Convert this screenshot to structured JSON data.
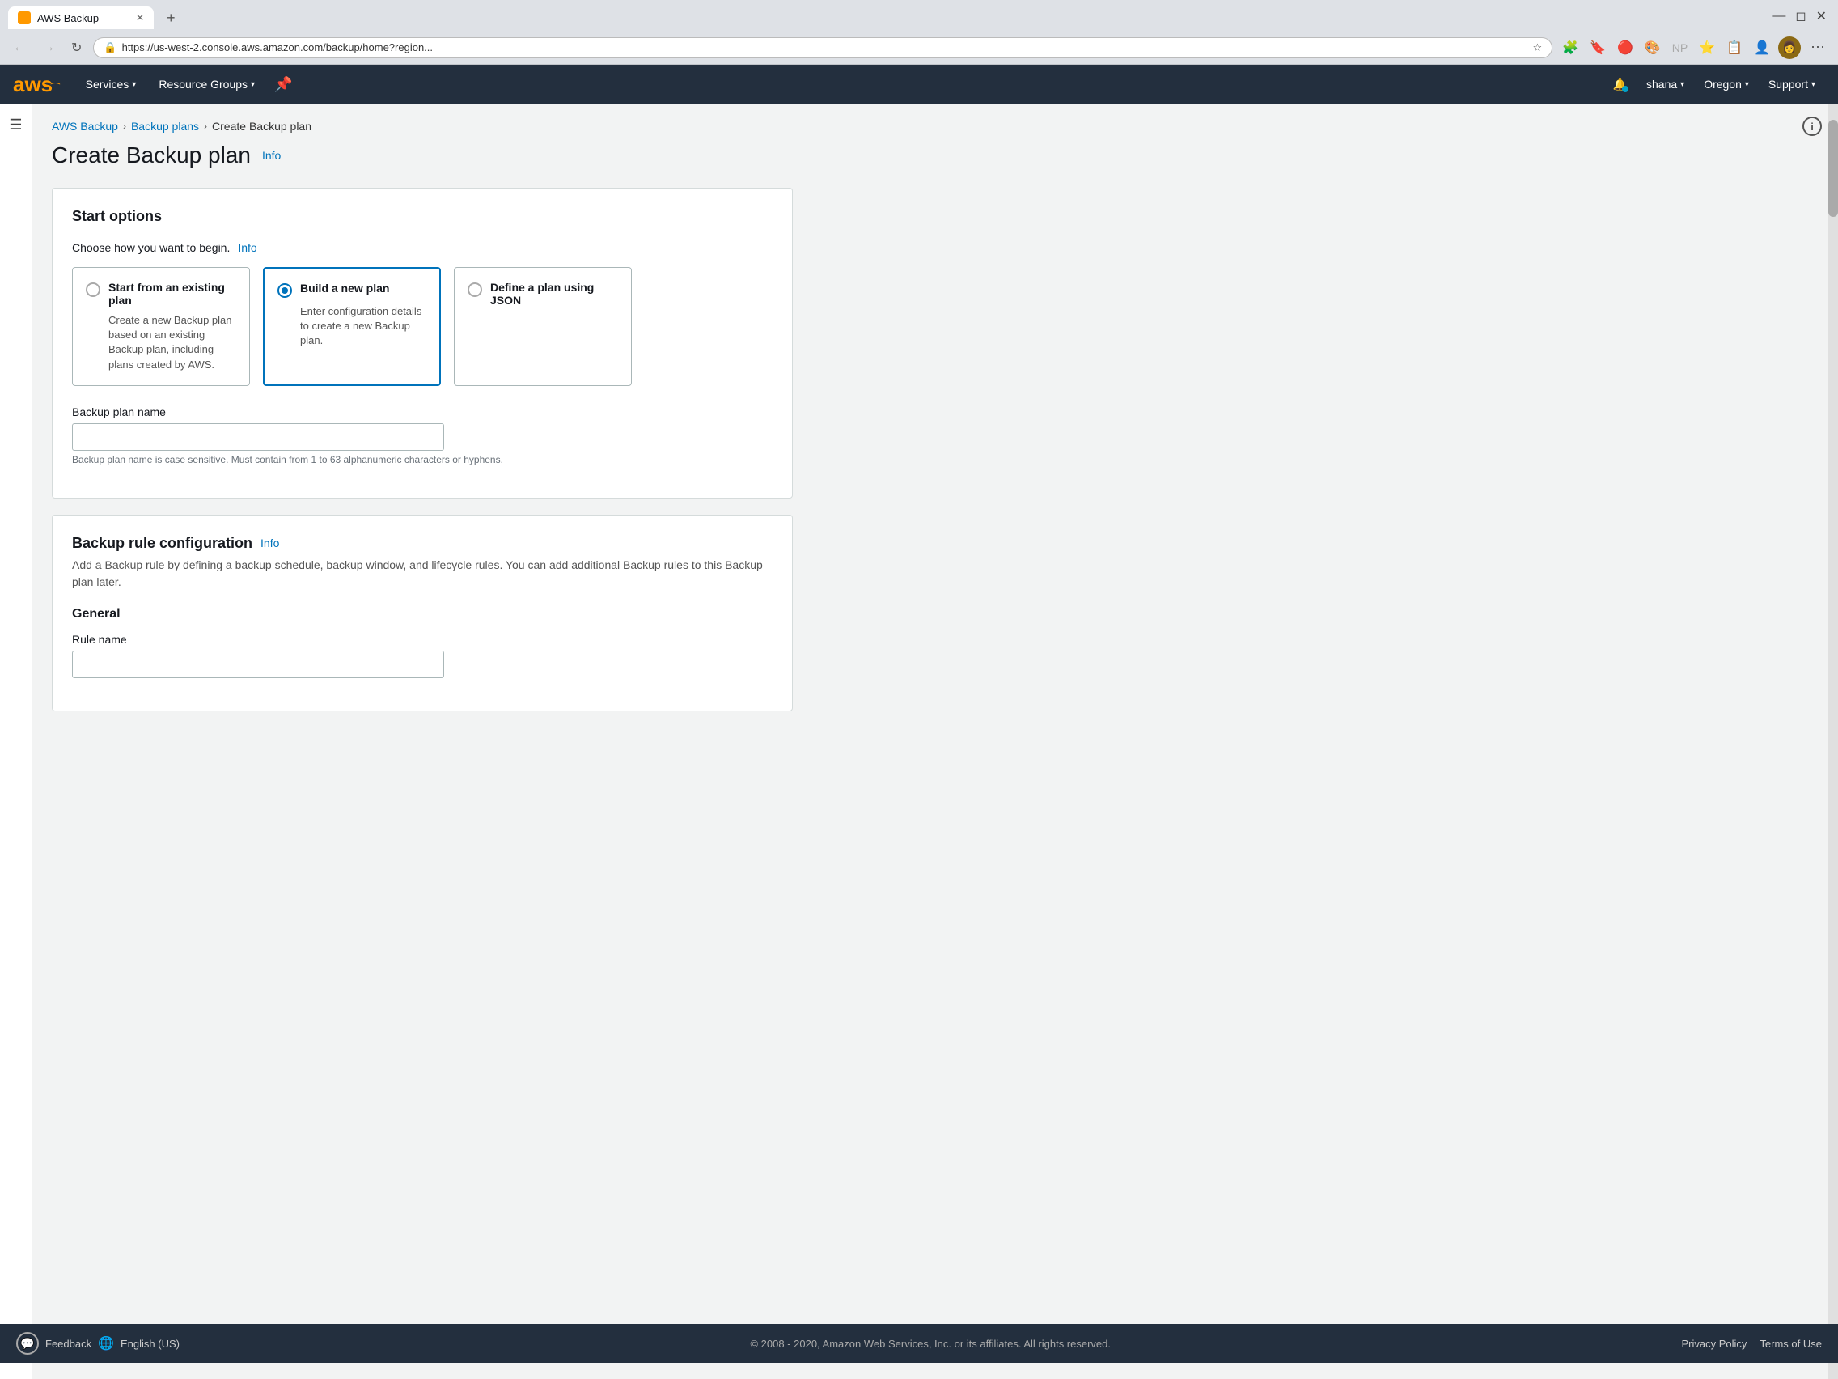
{
  "browser": {
    "tab_title": "AWS Backup",
    "tab_favicon": "🟠",
    "url": "https://us-west-2.console.aws.amazon.com/backup/home?region...",
    "new_tab_btn": "+",
    "back_btn": "←",
    "forward_btn": "→",
    "refresh_btn": "↻",
    "lock_icon": "🔒",
    "star_icon": "☆",
    "menu_btn": "⋯"
  },
  "aws_nav": {
    "logo_text": "aws",
    "services_label": "Services",
    "resource_groups_label": "Resource Groups",
    "bell_icon": "🔔",
    "user_name": "shana",
    "region_label": "Oregon",
    "support_label": "Support"
  },
  "breadcrumb": {
    "aws_backup": "AWS Backup",
    "backup_plans": "Backup plans",
    "current": "Create Backup plan"
  },
  "page": {
    "title": "Create Backup plan",
    "info_link": "Info"
  },
  "start_options": {
    "card_title": "Start options",
    "choose_label": "Choose how you want to begin.",
    "choose_info": "Info",
    "option1": {
      "title": "Start from an existing plan",
      "desc": "Create a new Backup plan based on an existing Backup plan, including plans created by AWS."
    },
    "option2": {
      "title": "Build a new plan",
      "desc": "Enter configuration details to create a new Backup plan."
    },
    "option3": {
      "title": "Define a plan using JSON"
    },
    "backup_plan_name_label": "Backup plan name",
    "backup_plan_name_placeholder": "",
    "backup_plan_name_hint": "Backup plan name is case sensitive. Must contain from 1 to 63 alphanumeric characters or hyphens."
  },
  "backup_rule_config": {
    "section_title": "Backup rule configuration",
    "info_link": "Info",
    "section_desc": "Add a Backup rule by defining a backup schedule, backup window, and lifecycle rules. You can add additional Backup rules to this Backup plan later.",
    "general_label": "General",
    "rule_name_label": "Rule name",
    "rule_name_placeholder": ""
  },
  "footer": {
    "feedback_label": "Feedback",
    "language_label": "English (US)",
    "copyright": "© 2008 - 2020, Amazon Web Services, Inc. or its affiliates. All rights reserved.",
    "privacy_policy": "Privacy Policy",
    "terms_of_use": "Terms of Use"
  }
}
